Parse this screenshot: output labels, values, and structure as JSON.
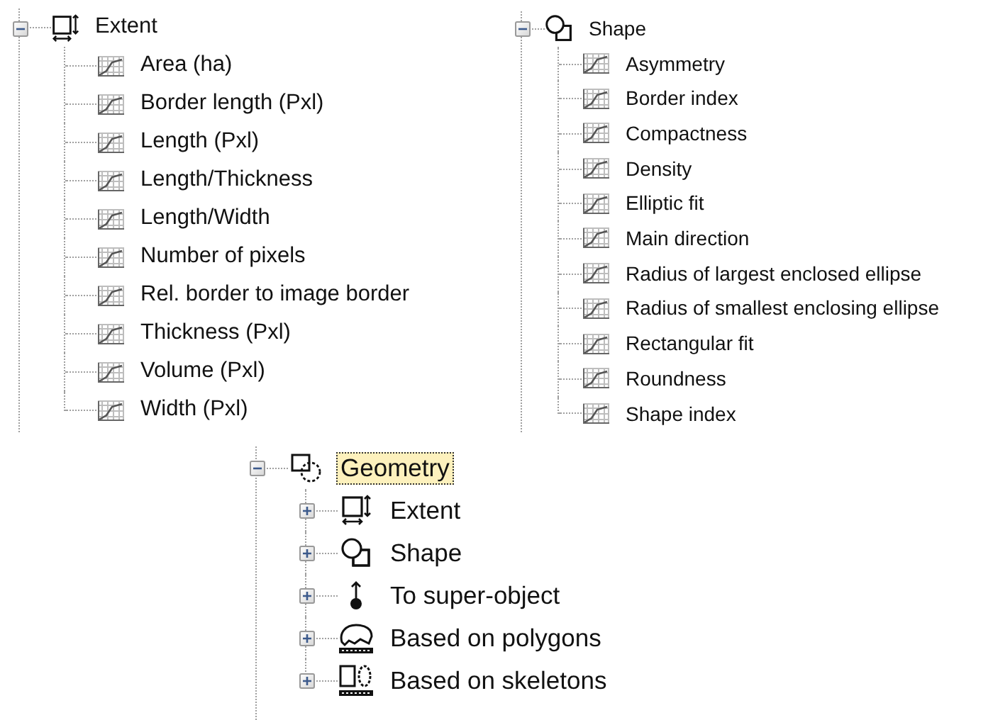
{
  "panels": [
    {
      "nodes": [
        {
          "label": "Extent",
          "kind": "extent",
          "expanded": true,
          "selected": false,
          "children": [
            {
              "label": "Area (ha)",
              "kind": "feature",
              "selected": false
            },
            {
              "label": "Border length (Pxl)",
              "kind": "feature",
              "selected": false
            },
            {
              "label": "Length (Pxl)",
              "kind": "feature",
              "selected": false
            },
            {
              "label": "Length/Thickness",
              "kind": "feature",
              "selected": false
            },
            {
              "label": "Length/Width",
              "kind": "feature",
              "selected": false
            },
            {
              "label": "Number of pixels",
              "kind": "feature",
              "selected": false
            },
            {
              "label": "Rel. border to image border",
              "kind": "feature",
              "selected": false
            },
            {
              "label": "Thickness (Pxl)",
              "kind": "feature",
              "selected": false
            },
            {
              "label": "Volume (Pxl)",
              "kind": "feature",
              "selected": false
            },
            {
              "label": "Width (Pxl)",
              "kind": "feature",
              "selected": false
            }
          ]
        }
      ]
    },
    {
      "nodes": [
        {
          "label": "Shape",
          "kind": "shape",
          "expanded": true,
          "selected": false,
          "children": [
            {
              "label": "Asymmetry",
              "kind": "feature",
              "selected": false
            },
            {
              "label": "Border index",
              "kind": "feature",
              "selected": false
            },
            {
              "label": "Compactness",
              "kind": "feature",
              "selected": false
            },
            {
              "label": "Density",
              "kind": "feature",
              "selected": false
            },
            {
              "label": "Elliptic fit",
              "kind": "feature",
              "selected": false
            },
            {
              "label": "Main direction",
              "kind": "feature",
              "selected": false
            },
            {
              "label": "Radius of largest enclosed ellipse",
              "kind": "feature",
              "selected": false
            },
            {
              "label": "Radius of smallest enclosing ellipse",
              "kind": "feature",
              "selected": false
            },
            {
              "label": "Rectangular fit",
              "kind": "feature",
              "selected": false
            },
            {
              "label": "Roundness",
              "kind": "feature",
              "selected": false
            },
            {
              "label": "Shape index",
              "kind": "feature",
              "selected": false
            }
          ]
        }
      ]
    },
    {
      "nodes": [
        {
          "label": "Geometry",
          "kind": "geometry",
          "expanded": true,
          "selected": true,
          "children": [
            {
              "label": "Extent",
              "kind": "extent",
              "expanded": false,
              "selected": false
            },
            {
              "label": "Shape",
              "kind": "shape",
              "expanded": false,
              "selected": false
            },
            {
              "label": "To super-object",
              "kind": "super-object",
              "expanded": false,
              "selected": false
            },
            {
              "label": "Based on polygons",
              "kind": "polygons",
              "expanded": false,
              "selected": false
            },
            {
              "label": "Based on skeletons",
              "kind": "skeletons",
              "expanded": false,
              "selected": false
            }
          ]
        }
      ]
    }
  ]
}
